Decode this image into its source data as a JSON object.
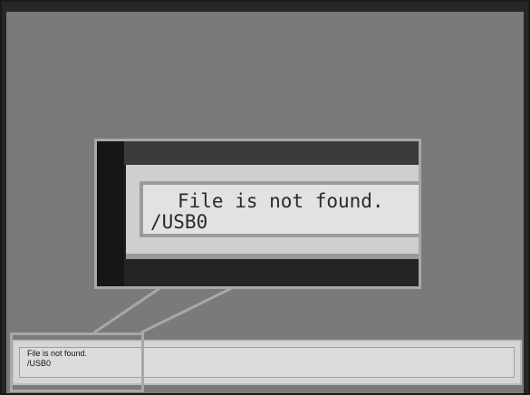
{
  "message": {
    "line1": "File is not found.",
    "line2": "/USB0"
  },
  "zoom": {
    "line1": "File is not found.",
    "line2": "/USB0"
  },
  "colors": {
    "screen_background": "#7a7a7a",
    "outer_frame": "#262626",
    "lcd_panel": "#dcdcdc",
    "highlight_outline": "#a8a8a8"
  }
}
